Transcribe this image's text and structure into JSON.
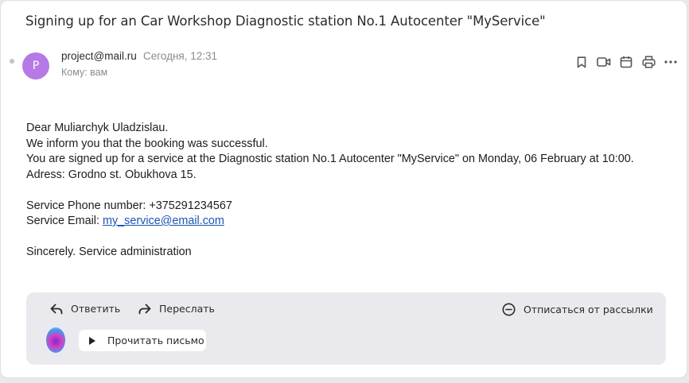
{
  "message": {
    "subject": "Signing up for an Car Workshop Diagnostic station No.1 Autocenter \"MyService\"",
    "sender": {
      "avatar_letter": "P",
      "avatar_color": "#b57ae6",
      "email": "project@mail.ru",
      "date": "Сегодня, 12:31",
      "to": "Кому: вам"
    },
    "toolbar_icons": [
      "bookmark-icon",
      "video-icon",
      "calendar-icon",
      "print-icon",
      "more-icon"
    ],
    "body": {
      "greeting": "Dear Muliarchyk Uladzislau.",
      "line1": "We inform you that the booking was successful.",
      "line2": "You are signed up for a service at the Diagnostic station No.1 Autocenter \"MyService\" on Monday, 06 February at 10:00.",
      "line3": "Adress: Grodno st. Obukhova 15.",
      "phone": "Service Phone number: +375291234567",
      "email_label": "Service Email: ",
      "email_link": "my_service@email.com",
      "signoff": "Sincerely. Service administration"
    }
  },
  "footer": {
    "reply": "Ответить",
    "forward": "Переслать",
    "unsubscribe": "Отписаться от рассылки",
    "read_aloud": "Прочитать письмо"
  },
  "colors": {
    "link": "#1a55b5",
    "footer_bg": "#eaeaee"
  }
}
